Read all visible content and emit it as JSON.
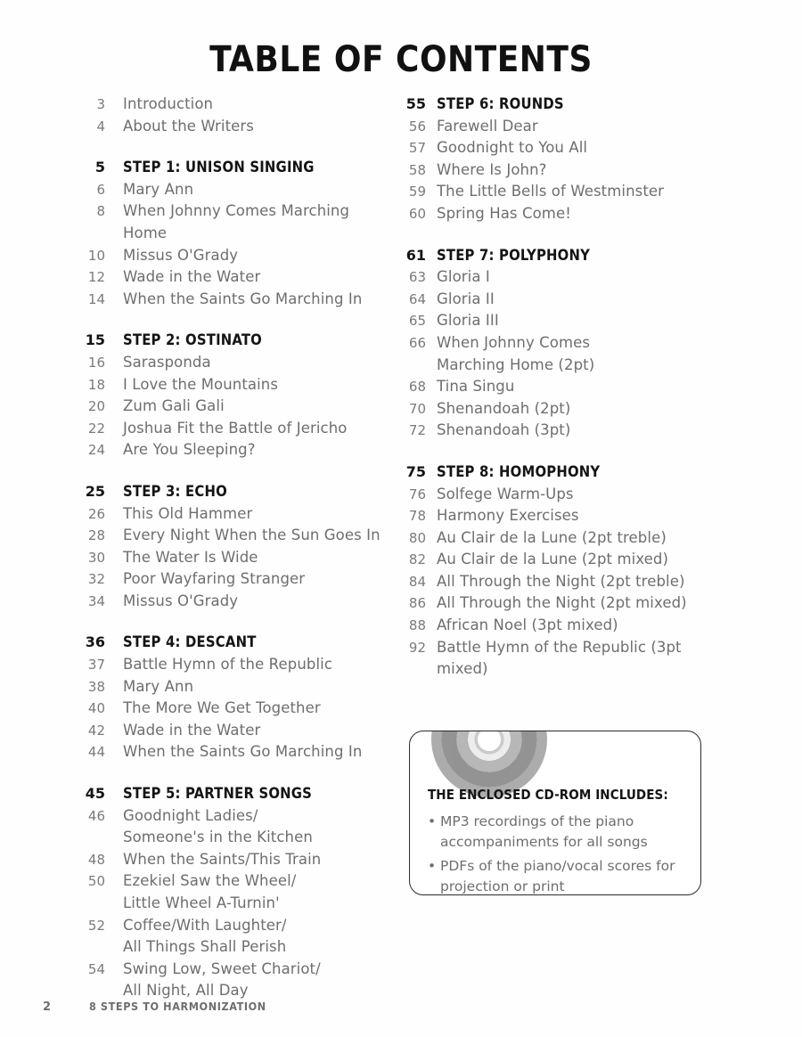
{
  "document": {
    "title": "TABLE OF CONTENTS"
  },
  "columns": {
    "left": [
      {
        "group_type": "front-matter",
        "spaced": false,
        "entries": [
          {
            "page": "3",
            "title": "Introduction",
            "is_section": false
          },
          {
            "page": "4",
            "title": "About the Writers",
            "is_section": false
          }
        ]
      },
      {
        "group_type": "step",
        "spaced": true,
        "entries": [
          {
            "page": "5",
            "title": "STEP 1: UNISON SINGING",
            "is_section": true
          },
          {
            "page": "6",
            "title": "Mary Ann",
            "is_section": false
          },
          {
            "page": "8",
            "title": "When Johnny Comes Marching Home",
            "is_section": false
          },
          {
            "page": "10",
            "title": "Missus O'Grady",
            "is_section": false
          },
          {
            "page": "12",
            "title": "Wade in the Water",
            "is_section": false
          },
          {
            "page": "14",
            "title": "When the Saints Go Marching In",
            "is_section": false
          }
        ]
      },
      {
        "group_type": "step",
        "spaced": true,
        "entries": [
          {
            "page": "15",
            "title": "STEP 2: OSTINATO",
            "is_section": true
          },
          {
            "page": "16",
            "title": "Sarasponda",
            "is_section": false
          },
          {
            "page": "18",
            "title": "I Love the Mountains",
            "is_section": false
          },
          {
            "page": "20",
            "title": "Zum Gali Gali",
            "is_section": false
          },
          {
            "page": "22",
            "title": "Joshua Fit the Battle of Jericho",
            "is_section": false
          },
          {
            "page": "24",
            "title": "Are You Sleeping?",
            "is_section": false
          }
        ]
      },
      {
        "group_type": "step",
        "spaced": true,
        "entries": [
          {
            "page": "25",
            "title": "STEP 3: ECHO",
            "is_section": true
          },
          {
            "page": "26",
            "title": "This Old Hammer",
            "is_section": false
          },
          {
            "page": "28",
            "title": "Every Night When the Sun Goes In",
            "is_section": false
          },
          {
            "page": "30",
            "title": "The Water Is Wide",
            "is_section": false
          },
          {
            "page": "32",
            "title": "Poor Wayfaring Stranger",
            "is_section": false
          },
          {
            "page": "34",
            "title": "Missus O'Grady",
            "is_section": false
          }
        ]
      },
      {
        "group_type": "step",
        "spaced": true,
        "entries": [
          {
            "page": "36",
            "title": "STEP 4: DESCANT",
            "is_section": true
          },
          {
            "page": "37",
            "title": "Battle Hymn of the Republic",
            "is_section": false
          },
          {
            "page": "38",
            "title": "Mary Ann",
            "is_section": false
          },
          {
            "page": "40",
            "title": "The More We Get Together",
            "is_section": false
          },
          {
            "page": "42",
            "title": "Wade in the Water",
            "is_section": false
          },
          {
            "page": "44",
            "title": "When the Saints Go Marching In",
            "is_section": false
          }
        ]
      },
      {
        "group_type": "step",
        "spaced": true,
        "entries": [
          {
            "page": "45",
            "title": "STEP 5: PARTNER SONGS",
            "is_section": true
          },
          {
            "page": "46",
            "title": "Goodnight Ladies/",
            "title_line2": "Someone's in the Kitchen",
            "is_section": false
          },
          {
            "page": "48",
            "title": "When the Saints/This Train",
            "is_section": false
          },
          {
            "page": "50",
            "title": "Ezekiel Saw the Wheel/",
            "title_line2": "Little Wheel A-Turnin'",
            "is_section": false
          },
          {
            "page": "52",
            "title": "Coffee/With Laughter/",
            "title_line2": "All Things Shall Perish",
            "is_section": false
          },
          {
            "page": "54",
            "title": "Swing Low, Sweet Chariot/",
            "title_line2": "All Night, All Day",
            "is_section": false
          }
        ]
      }
    ],
    "right": [
      {
        "group_type": "step",
        "spaced": false,
        "entries": [
          {
            "page": "55",
            "title": "STEP 6: ROUNDS",
            "is_section": true
          },
          {
            "page": "56",
            "title": "Farewell Dear",
            "is_section": false
          },
          {
            "page": "57",
            "title": "Goodnight to You All",
            "is_section": false
          },
          {
            "page": "58",
            "title": "Where Is John?",
            "is_section": false
          },
          {
            "page": "59",
            "title": "The Little Bells of Westminster",
            "is_section": false
          },
          {
            "page": "60",
            "title": "Spring Has Come!",
            "is_section": false
          }
        ]
      },
      {
        "group_type": "step",
        "spaced": true,
        "entries": [
          {
            "page": "61",
            "title": "STEP 7: POLYPHONY",
            "is_section": true
          },
          {
            "page": "63",
            "title": "Gloria I",
            "is_section": false
          },
          {
            "page": "64",
            "title": "Gloria II",
            "is_section": false
          },
          {
            "page": "65",
            "title": "Gloria III",
            "is_section": false
          },
          {
            "page": "66",
            "title": "When Johnny Comes",
            "title_line2": "Marching Home (2pt)",
            "is_section": false
          },
          {
            "page": "68",
            "title": "Tina Singu",
            "is_section": false
          },
          {
            "page": "70",
            "title": "Shenandoah (2pt)",
            "is_section": false
          },
          {
            "page": "72",
            "title": "Shenandoah (3pt)",
            "is_section": false
          }
        ]
      },
      {
        "group_type": "step",
        "spaced": true,
        "entries": [
          {
            "page": "75",
            "title": "STEP 8: HOMOPHONY",
            "is_section": true
          },
          {
            "page": "76",
            "title": "Solfege Warm-Ups",
            "is_section": false
          },
          {
            "page": "78",
            "title": "Harmony Exercises",
            "is_section": false
          },
          {
            "page": "80",
            "title": "Au Clair de la Lune (2pt treble)",
            "is_section": false
          },
          {
            "page": "82",
            "title": "Au Clair de la Lune (2pt mixed)",
            "is_section": false
          },
          {
            "page": "84",
            "title": "All Through the Night (2pt treble)",
            "is_section": false
          },
          {
            "page": "86",
            "title": "All Through the Night (2pt mixed)",
            "is_section": false
          },
          {
            "page": "88",
            "title": "African Noel (3pt mixed)",
            "is_section": false
          },
          {
            "page": "92",
            "title": "Battle Hymn of the Republic (3pt mixed)",
            "is_section": false
          }
        ]
      }
    ]
  },
  "cd_box": {
    "heading": "THE ENCLOSED CD-ROM INCLUDES:",
    "bullet_glyph": "•",
    "items": [
      "MP3 recordings of the piano accompaniments for all songs",
      "PDFs of the piano/vocal scores for projection or print"
    ]
  },
  "footer": {
    "page_number": "2",
    "book_title": "8 STEPS TO HARMONIZATION"
  },
  "colors": {
    "heading_text": "#141414",
    "entry_text": "#6e6e6e",
    "number_text": "#7a7a7a",
    "box_border": "#2a2a2a",
    "background": "#ffffff"
  }
}
